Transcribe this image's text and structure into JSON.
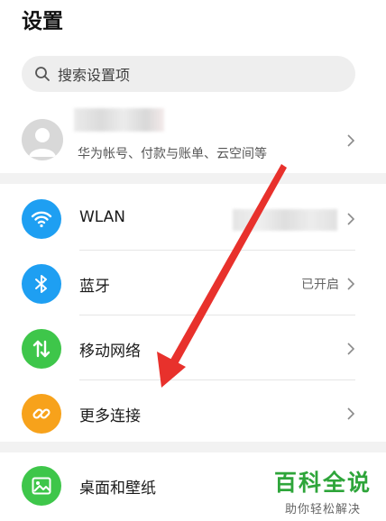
{
  "header": {
    "title": "设置"
  },
  "search": {
    "placeholder": "搜索设置项"
  },
  "account": {
    "subtitle": "华为帐号、付款与账单、云空间等"
  },
  "settings": [
    {
      "label": "WLAN",
      "value": "",
      "icon": "wifi-icon",
      "color": "#1e9ff2"
    },
    {
      "label": "蓝牙",
      "value": "已开启",
      "icon": "bluetooth-icon",
      "color": "#1e9ff2"
    },
    {
      "label": "移动网络",
      "value": "",
      "icon": "mobile-data-icon",
      "color": "#3ec64a"
    },
    {
      "label": "更多连接",
      "value": "",
      "icon": "link-icon",
      "color": "#f7a21b"
    }
  ],
  "settings2": [
    {
      "label": "桌面和壁纸",
      "icon": "wallpaper-icon",
      "color": "#3ec64a"
    }
  ],
  "watermark": {
    "main": "百科全说",
    "sub": "助你轻松解决"
  },
  "annotation": {
    "color": "#e8312c"
  }
}
